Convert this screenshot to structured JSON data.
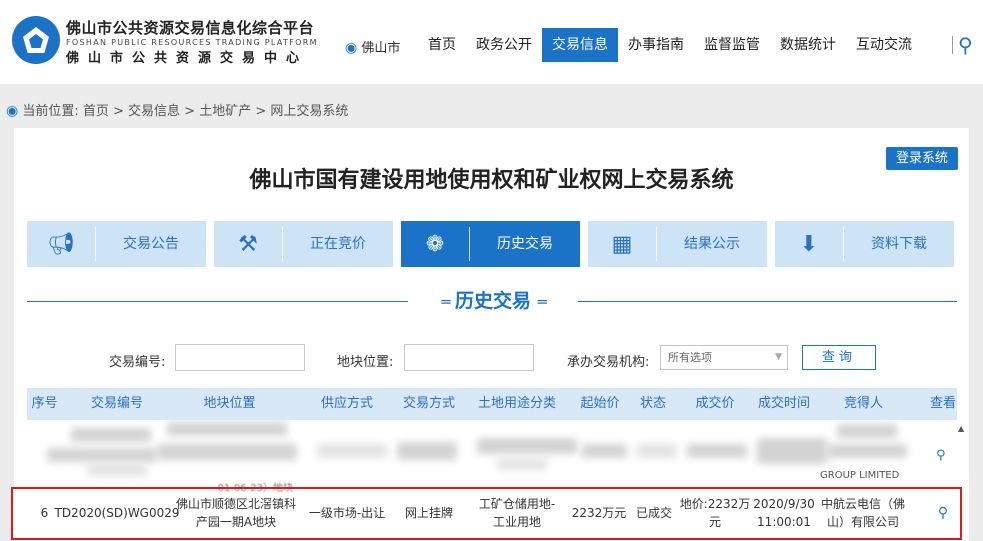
{
  "header": {
    "logo_cn": "佛山市公共资源交易信息化综合平台",
    "logo_en": "FOSHAN PUBLIC RESOURCES TRADING PLATFORM",
    "logo_cn2": "佛山市公共资源交易中心",
    "city": "佛山市",
    "nav": [
      "首页",
      "政务公开",
      "交易信息",
      "办事指南",
      "监督监管",
      "数据统计",
      "互动交流"
    ],
    "active_nav": "交易信息"
  },
  "breadcrumb": {
    "prefix": "当前位置:",
    "path": "首页 > 交易信息 > 土地矿产 > 网上交易系统"
  },
  "panel": {
    "login_label": "登录系统",
    "title": "佛山市国有建设用地使用权和矿业权网上交易系统",
    "tabs": [
      {
        "label": "交易公告",
        "icon": "megaphone-icon"
      },
      {
        "label": "正在竞价",
        "icon": "gavel-icon"
      },
      {
        "label": "历史交易",
        "icon": "handshake-icon"
      },
      {
        "label": "结果公示",
        "icon": "clipboard-icon"
      },
      {
        "label": "资料下载",
        "icon": "download-icon"
      }
    ],
    "active_tab": "历史交易",
    "section_title": "历史交易"
  },
  "filters": {
    "trade_no_label": "交易编号:",
    "trade_no_value": "",
    "location_label": "地块位置:",
    "location_value": "",
    "agency_label": "承办交易机构:",
    "agency_selected": "所有选项",
    "query_label": "查询"
  },
  "table": {
    "headers": [
      "序号",
      "交易编号",
      "地块位置",
      "供应方式",
      "交易方式",
      "土地用途分类",
      "起始价",
      "状态",
      "成交价",
      "成交时间",
      "竞得人",
      "查看"
    ],
    "blurred_fragments": {
      "date_fragment": "-01-06-23）地块",
      "company_fragment": "GROUP LIMITED"
    },
    "rows": [
      {
        "no": "6",
        "trade_no": "TD2020(SD)WG0029",
        "location": "佛山市顺德区北滘镇科产园一期A地块",
        "supply": "一级市场-出让",
        "method": "网上挂牌",
        "use": "工矿仓储用地-工业用地",
        "start_price": "2232万元",
        "status": "已成交",
        "deal_price": "地价:2232万元",
        "deal_time": "2020/9/30 11:00:01",
        "winner": "中航云电信（佛山）有限公司"
      }
    ]
  }
}
